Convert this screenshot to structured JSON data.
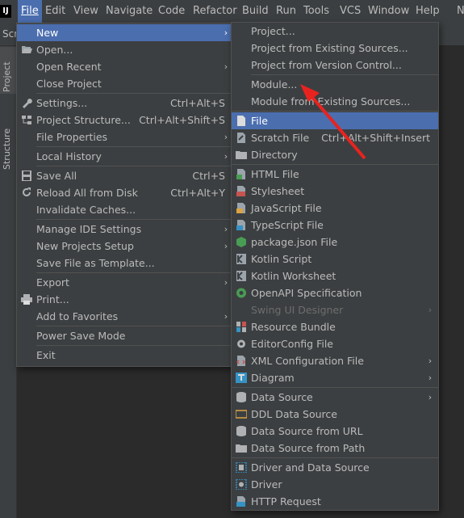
{
  "menubar": {
    "app_icon": "IJ",
    "items": [
      "File",
      "Edit",
      "View",
      "Navigate",
      "Code",
      "Refactor",
      "Build",
      "Run",
      "Tools",
      "VCS",
      "Window",
      "Help",
      "N"
    ]
  },
  "left_tabs": {
    "project": "Project",
    "structure": "Structure",
    "partial": "Scr"
  },
  "file_menu": {
    "new": "New",
    "open": "Open...",
    "open_recent": "Open Recent",
    "close_project": "Close Project",
    "settings": "Settings...",
    "settings_sc": "Ctrl+Alt+S",
    "project_structure": "Project Structure...",
    "project_structure_sc": "Ctrl+Alt+Shift+S",
    "file_properties": "File Properties",
    "local_history": "Local History",
    "save_all": "Save All",
    "save_all_sc": "Ctrl+S",
    "reload": "Reload All from Disk",
    "reload_sc": "Ctrl+Alt+Y",
    "invalidate": "Invalidate Caches...",
    "manage_ide": "Manage IDE Settings",
    "new_projects_setup": "New Projects Setup",
    "save_template": "Save File as Template...",
    "export": "Export",
    "print": "Print...",
    "add_favorites": "Add to Favorites",
    "power_save": "Power Save Mode",
    "exit": "Exit"
  },
  "new_menu": {
    "project": "Project...",
    "project_existing": "Project from Existing Sources...",
    "project_vcs": "Project from Version Control...",
    "module": "Module...",
    "module_existing": "Module from Existing Sources...",
    "file": "File",
    "scratch": "Scratch File",
    "scratch_sc": "Ctrl+Alt+Shift+Insert",
    "directory": "Directory",
    "html": "HTML File",
    "stylesheet": "Stylesheet",
    "js": "JavaScript File",
    "ts": "TypeScript File",
    "packagejson": "package.json File",
    "kotlin_script": "Kotlin Script",
    "kotlin_worksheet": "Kotlin Worksheet",
    "openapi": "OpenAPI Specification",
    "swing": "Swing UI Designer",
    "resource_bundle": "Resource Bundle",
    "editorconfig": "EditorConfig File",
    "xml_config": "XML Configuration File",
    "diagram": "Diagram",
    "data_source": "Data Source",
    "ddl": "DDL Data Source",
    "ds_url": "Data Source from URL",
    "ds_path": "Data Source from Path",
    "driver_ds": "Driver and Data Source",
    "driver": "Driver",
    "http": "HTTP Request"
  },
  "colors": {
    "menu_bg": "#3c3f41",
    "selection": "#4b6eaf",
    "annotation": "#e8231f"
  }
}
